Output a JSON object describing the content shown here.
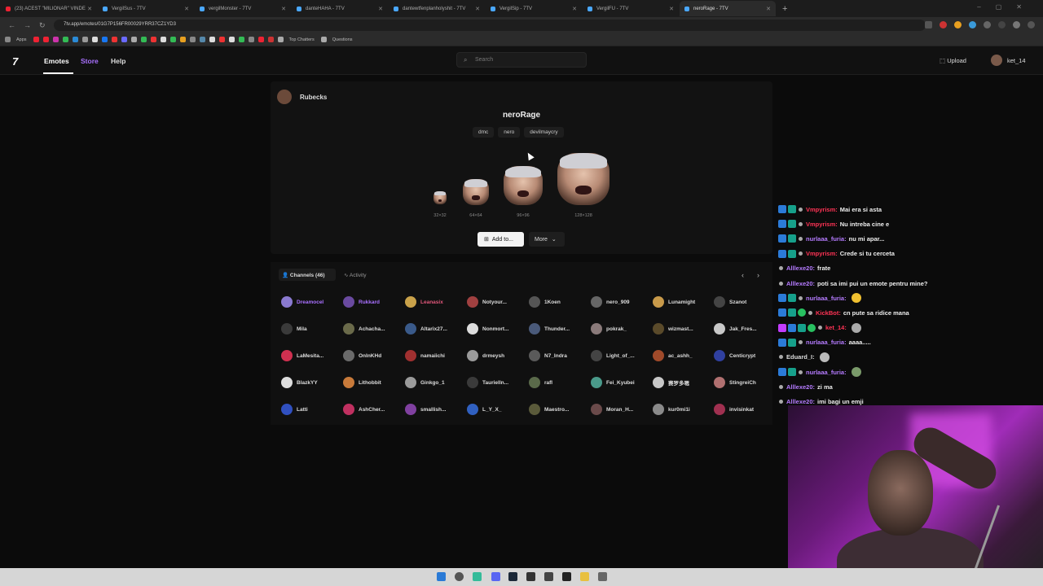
{
  "browser": {
    "tabs": [
      {
        "title": "(23) ACEST \"MILIONAR\" VINDE",
        "icon": "youtube-icon",
        "active": false
      },
      {
        "title": "VergilSus - 7TV",
        "icon": "7tv-icon",
        "active": false
      },
      {
        "title": "vergilMonster - 7TV",
        "icon": "7tv-icon",
        "active": false
      },
      {
        "title": "danteHAHA - 7TV",
        "icon": "7tv-icon",
        "active": false
      },
      {
        "title": "dantewtfenplanholyshit - 7TV",
        "icon": "7tv-icon",
        "active": false
      },
      {
        "title": "VergilSip - 7TV",
        "icon": "7tv-icon",
        "active": false
      },
      {
        "title": "VergilFU - 7TV",
        "icon": "7tv-icon",
        "active": false
      },
      {
        "title": "neroRage - 7TV",
        "icon": "7tv-icon",
        "active": true
      }
    ],
    "url": "7tv.app/emotes/01G7P156FR00029YRR37CZ1YD3",
    "bookmarks": {
      "apps": "Apps",
      "top_chatters": "Top Chatters",
      "questions": "Questions"
    }
  },
  "site": {
    "nav": {
      "emotes": "Emotes",
      "store": "Store",
      "help": "Help"
    },
    "search_placeholder": "Search",
    "upload": "Upload",
    "username": "ket_14"
  },
  "emote": {
    "author": "Rubecks",
    "name": "neroRage",
    "tags": [
      "dmc",
      "nero",
      "devilmaycry"
    ],
    "sizes": [
      "32×32",
      "64×64",
      "96×96",
      "128×128"
    ],
    "add_button": "Add to...",
    "more_button": "More"
  },
  "channels": {
    "tab_label": "Channels (46)",
    "activity_label": "Activity",
    "list": [
      {
        "name": "Dreamocel",
        "color": "#a970ff",
        "avatar": "#8a7ad0"
      },
      {
        "name": "Rukkard",
        "color": "#a970ff",
        "avatar": "#6a4aa0"
      },
      {
        "name": "Leanasix",
        "color": "#e0577a",
        "avatar": "#c9a24a"
      },
      {
        "name": "Notyour...",
        "color": "#dddddd",
        "avatar": "#a04040"
      },
      {
        "name": "1Koen",
        "color": "#dddddd",
        "avatar": "#555555"
      },
      {
        "name": "nero_909",
        "color": "#dddddd",
        "avatar": "#666666"
      },
      {
        "name": "Lunamight",
        "color": "#dddddd",
        "avatar": "#c89a4a"
      },
      {
        "name": "Szanot",
        "color": "#dddddd",
        "avatar": "#444444"
      },
      {
        "name": "Mila",
        "color": "#dddddd",
        "avatar": "#3a3a3a"
      },
      {
        "name": "Achacha...",
        "color": "#dddddd",
        "avatar": "#6a6a4a"
      },
      {
        "name": "Altarix27...",
        "color": "#dddddd",
        "avatar": "#3a5a8a"
      },
      {
        "name": "Nonmort...",
        "color": "#dddddd",
        "avatar": "#dddddd"
      },
      {
        "name": "Thunder...",
        "color": "#dddddd",
        "avatar": "#4a5a7a"
      },
      {
        "name": "pokrak_",
        "color": "#dddddd",
        "avatar": "#8a7a7a"
      },
      {
        "name": "wizmast...",
        "color": "#dddddd",
        "avatar": "#5a4a2a"
      },
      {
        "name": "Jak_Fres...",
        "color": "#dddddd",
        "avatar": "#c8c8c8"
      },
      {
        "name": "LaMesita...",
        "color": "#dddddd",
        "avatar": "#d03050"
      },
      {
        "name": "OnInKHd",
        "color": "#dddddd",
        "avatar": "#6a6a6a"
      },
      {
        "name": "namaiichi",
        "color": "#dddddd",
        "avatar": "#a03030"
      },
      {
        "name": "drmeysh",
        "color": "#dddddd",
        "avatar": "#9a9a9a"
      },
      {
        "name": "N7_Indra",
        "color": "#dddddd",
        "avatar": "#5a5a5a"
      },
      {
        "name": "Light_of_...",
        "color": "#dddddd",
        "avatar": "#444444"
      },
      {
        "name": "ac_ashh_",
        "color": "#dddddd",
        "avatar": "#a04a2a"
      },
      {
        "name": "Centicrypt",
        "color": "#dddddd",
        "avatar": "#3040a0"
      },
      {
        "name": "BlazkYY",
        "color": "#dddddd",
        "avatar": "#dddddd"
      },
      {
        "name": "Lithobbit",
        "color": "#dddddd",
        "avatar": "#c87a3a"
      },
      {
        "name": "Ginkgo_1",
        "color": "#dddddd",
        "avatar": "#9a9a9a"
      },
      {
        "name": "Taurielln...",
        "color": "#dddddd",
        "avatar": "#3a3a3a"
      },
      {
        "name": "rafl",
        "color": "#dddddd",
        "avatar": "#5a6a4a"
      },
      {
        "name": "Fei_Kyubei",
        "color": "#dddddd",
        "avatar": "#4a9a8a"
      },
      {
        "name": "赛罗多嗯",
        "color": "#dddddd",
        "avatar": "#c8c8c8"
      },
      {
        "name": "StingreiCh",
        "color": "#dddddd",
        "avatar": "#b07070"
      },
      {
        "name": "Latti",
        "color": "#dddddd",
        "avatar": "#3050c0"
      },
      {
        "name": "AshCher...",
        "color": "#dddddd",
        "avatar": "#c03060"
      },
      {
        "name": "smallish...",
        "color": "#dddddd",
        "avatar": "#8040a0"
      },
      {
        "name": "L_Y_X_",
        "color": "#dddddd",
        "avatar": "#3060c0"
      },
      {
        "name": "Maestro...",
        "color": "#dddddd",
        "avatar": "#5a5a3a"
      },
      {
        "name": "Moran_H...",
        "color": "#dddddd",
        "avatar": "#6a4a4a"
      },
      {
        "name": "kur0mi1i",
        "color": "#dddddd",
        "avatar": "#8a8a8a"
      },
      {
        "name": "invisinkat",
        "color": "#dddddd",
        "avatar": "#a03050"
      }
    ]
  },
  "chat": [
    {
      "user": "Vmpyrism:",
      "color": "#ff3355",
      "text": "Mai era si asta",
      "badges": 2,
      "emoji": ""
    },
    {
      "user": "Vmpyrism:",
      "color": "#ff3355",
      "text": "Nu intreba cine e",
      "badges": 2,
      "emoji": ""
    },
    {
      "user": "nurlaaa_furia:",
      "color": "#b57bff",
      "text": "nu mi apar...",
      "badges": 2,
      "emoji": ""
    },
    {
      "user": "Vmpyrism:",
      "color": "#ff3355",
      "text": "Crede si tu cerceta",
      "badges": 2,
      "emoji": ""
    },
    {
      "user": "Alllexe20:",
      "color": "#b57bff",
      "text": "frate",
      "badges": 0,
      "emoji": ""
    },
    {
      "user": "Alllexe20:",
      "color": "#b57bff",
      "text": "poti sa imi pui un emote pentru mine?",
      "badges": 0,
      "emoji": ""
    },
    {
      "user": "nurlaaa_furia:",
      "color": "#b57bff",
      "text": "",
      "badges": 2,
      "emoji": "#f0c030"
    },
    {
      "user": "KickBot:",
      "color": "#ff3355",
      "text": "cn pute sa ridice mana",
      "badges": 3,
      "emoji": ""
    },
    {
      "user": "ket_14:",
      "color": "#ff3355",
      "text": "",
      "badges": 4,
      "emoji": "#aaaaaa"
    },
    {
      "user": "nurlaaa_furia:",
      "color": "#b57bff",
      "text": "aaaa.....",
      "badges": 2,
      "emoji": ""
    },
    {
      "user": "Eduard_I:",
      "color": "#dddddd",
      "text": "",
      "badges": 0,
      "emoji": "#bbbbbb"
    },
    {
      "user": "nurlaaa_furia:",
      "color": "#b57bff",
      "text": "",
      "badges": 2,
      "emoji": "#7a9a6a"
    },
    {
      "user": "Alllexe20:",
      "color": "#b57bff",
      "text": "zi ma",
      "badges": 0,
      "emoji": ""
    },
    {
      "user": "Alllexe20:",
      "color": "#b57bff",
      "text": "imi bagi un emji",
      "badges": 0,
      "emoji": ""
    }
  ],
  "colors": {
    "accent": "#a970ff",
    "store": "#a970ff",
    "page_bg": "#0b0b0b"
  }
}
